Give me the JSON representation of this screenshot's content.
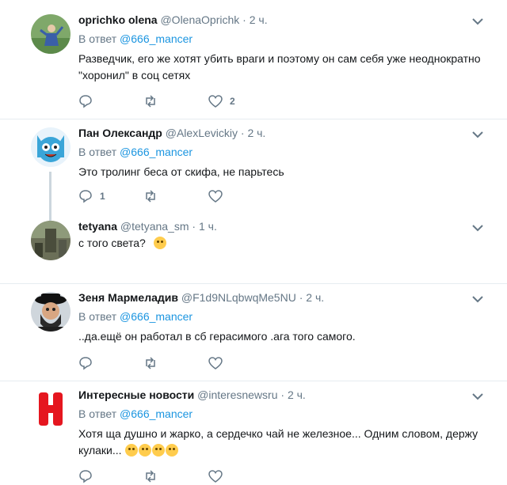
{
  "tweets": [
    {
      "name": "oprichko olena",
      "handle": "@OlenaOprichk",
      "time": "2 ч.",
      "reply_prefix": "В ответ",
      "reply_to": "@666_mancer",
      "text": "Разведчик, его же хотят убить  враги и поэтому он сам себя уже неоднократно \"хоронил\" в соц сетях",
      "reply_count": "",
      "retweet_count": "",
      "like_count": "2"
    },
    {
      "name": "Пан Олександр",
      "handle": "@AlexLevickiy",
      "time": "2 ч.",
      "reply_prefix": "В ответ",
      "reply_to": "@666_mancer",
      "text": "Это тролинг беса от скифа, не парьтесь",
      "reply_count": "1",
      "retweet_count": "",
      "like_count": ""
    },
    {
      "name": "tetyana",
      "handle": "@tetyana_sm",
      "time": "1 ч.",
      "text": "с того света?",
      "reply_count": "",
      "retweet_count": "",
      "like_count": ""
    },
    {
      "name": "Зеня Мармеладив",
      "handle": "@F1d9NLqbwqMe5NU",
      "time": "2 ч.",
      "reply_prefix": "В ответ",
      "reply_to": "@666_mancer",
      "text": "..да.ещё он работал в сб герасимого .ага того самого.",
      "reply_count": "",
      "retweet_count": "",
      "like_count": ""
    },
    {
      "name": "Интересные новости",
      "handle": "@interesnewsru",
      "time": "2 ч.",
      "reply_prefix": "В ответ",
      "reply_to": "@666_mancer",
      "text": "Хотя ща душно и жарко, а сердечко чай не железное... Одним словом, держу кулаки...",
      "reply_count": "",
      "retweet_count": "",
      "like_count": ""
    }
  ],
  "separator": "·",
  "colors": {
    "link": "#1b95e0",
    "muted": "#657786",
    "border": "#e6ecf0"
  }
}
